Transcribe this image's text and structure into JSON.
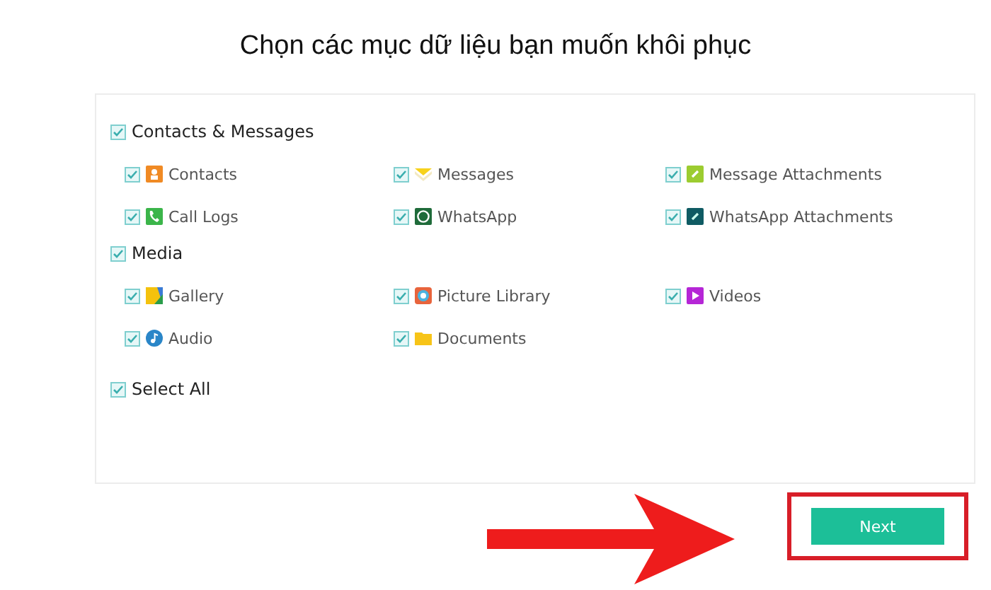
{
  "title": "Chọn các mục dữ liệu bạn muốn khôi phục",
  "sections": [
    {
      "label": "Contacts & Messages",
      "checked": true,
      "items": [
        {
          "label": "Contacts",
          "checked": true,
          "kind": "contacts"
        },
        {
          "label": "Messages",
          "checked": true,
          "kind": "messages"
        },
        {
          "label": "Message Attachments",
          "checked": true,
          "kind": "attachment"
        },
        {
          "label": "Call Logs",
          "checked": true,
          "kind": "calls"
        },
        {
          "label": "WhatsApp",
          "checked": true,
          "kind": "chat"
        },
        {
          "label": "WhatsApp Attachments",
          "checked": true,
          "kind": "chatattachment"
        }
      ]
    },
    {
      "label": "Media",
      "checked": true,
      "items": [
        {
          "label": "Gallery",
          "checked": true,
          "kind": "gallery"
        },
        {
          "label": "Picture Library",
          "checked": true,
          "kind": "pictures"
        },
        {
          "label": "Videos",
          "checked": true,
          "kind": "video"
        },
        {
          "label": "Audio",
          "checked": true,
          "kind": "audio"
        },
        {
          "label": "Documents",
          "checked": true,
          "kind": "folder"
        }
      ]
    }
  ],
  "select_all": {
    "label": "Select All",
    "checked": true
  },
  "next_button": "Next"
}
